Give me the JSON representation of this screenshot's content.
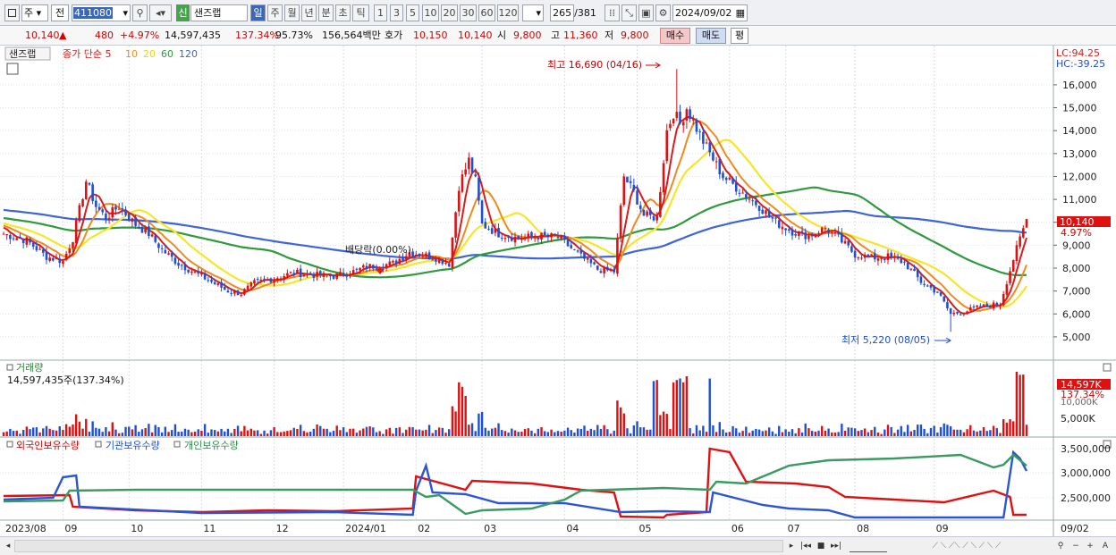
{
  "toolbar": {
    "mode_1": "주",
    "mode_2": "전",
    "code": "411080",
    "sin": "신",
    "name": "샌즈랩",
    "periods": [
      "일",
      "주",
      "월",
      "년",
      "분",
      "초",
      "틱"
    ],
    "ticks": [
      "1",
      "3",
      "5",
      "10",
      "20",
      "30",
      "60",
      "120"
    ],
    "page": "265",
    "page_total": "/381",
    "date": "2024/09/02"
  },
  "info": {
    "price": "10,140",
    "arrow": "▲",
    "change": "480",
    "change_pct": "+4.97%",
    "volume": "14,597,435",
    "vol_ratio": "137.34%",
    "ratio2": "95.73%",
    "amount": "156,564백만",
    "quote_label": "호가",
    "quote1": "10,150",
    "quote2": "10,140",
    "open_label": "시",
    "open": "9,800",
    "high_label": "고",
    "high": "11,360",
    "low_label": "저",
    "low": "9,800",
    "buy": "매수",
    "sell": "매도",
    "f": "평"
  },
  "price_panel": {
    "legend_name": "샌즈랩",
    "legend_ma": "종가 단순 5",
    "ma10": "10",
    "ma20": "20",
    "ma60": "60",
    "ma120": "120",
    "lc": "LC:94.25",
    "hc": "HC:-39.25",
    "max_label": "최고 16,690 (04/16)",
    "min_label": "최저 5,220 (08/05)",
    "div_label": "배당락(0.00%)",
    "cur_price": "10,140",
    "cur_pct": "4.97%"
  },
  "volume_panel": {
    "title": "거래량",
    "value": "14,597,435주(137.34%)",
    "tag1": "14,597K",
    "tag2": "137.34%",
    "tag3": "10,000K",
    "tag4": "5,000K"
  },
  "holding_panel": {
    "legend1": "외국인보유수량",
    "legend2": "기관보유수량",
    "legend3": "개인보유수량"
  },
  "x_labels": [
    "2023/08",
    "09",
    "10",
    "11",
    "12",
    "2024/01",
    "02",
    "03",
    "04",
    "05",
    "06",
    "07",
    "08",
    "09",
    "09/02"
  ],
  "colors": {
    "up": "#e01010",
    "down": "#1f4fd6",
    "ma5": "#d81d1d",
    "ma10": "#f08a1b",
    "ma20": "#f7e528",
    "ma60": "#2f9a3c",
    "ma120": "#3f63d8",
    "foreign": "#e01010",
    "inst": "#2b55d6",
    "indiv": "#3a9a5f"
  },
  "chart_data": [
    {
      "type": "candlestick",
      "title": "샌즈랩",
      "y_ticks": [
        16000,
        15000,
        14000,
        13000,
        12000,
        11000,
        10000,
        9000,
        8000,
        7000,
        6000,
        5000
      ],
      "ylim": [
        4450,
        17400
      ],
      "high": {
        "date": "2024/04/16",
        "value": 16690
      },
      "low": {
        "date": "2024/08/05",
        "value": 5220
      },
      "last": 10140,
      "price_path": [
        [
          0,
          9500
        ],
        [
          7,
          9200
        ],
        [
          13,
          8500
        ],
        [
          18,
          8300
        ],
        [
          21,
          9300
        ],
        [
          25,
          11800
        ],
        [
          28,
          10700
        ],
        [
          31,
          10200
        ],
        [
          35,
          10700
        ],
        [
          40,
          9900
        ],
        [
          44,
          9500
        ],
        [
          48,
          8800
        ],
        [
          53,
          8200
        ],
        [
          58,
          7800
        ],
        [
          63,
          7400
        ],
        [
          68,
          7000
        ],
        [
          72,
          6900
        ],
        [
          76,
          7350
        ],
        [
          83,
          7600
        ],
        [
          88,
          7800
        ],
        [
          94,
          7700
        ],
        [
          100,
          7650
        ],
        [
          105,
          7800
        ],
        [
          110,
          8050
        ],
        [
          118,
          8200
        ],
        [
          123,
          8700
        ],
        [
          131,
          8450
        ],
        [
          135,
          8200
        ],
        [
          138,
          11600
        ],
        [
          141,
          12700
        ],
        [
          143,
          11800
        ],
        [
          145,
          9900
        ],
        [
          150,
          9500
        ],
        [
          156,
          9300
        ],
        [
          162,
          9400
        ],
        [
          168,
          9350
        ],
        [
          175,
          8500
        ],
        [
          180,
          7950
        ],
        [
          185,
          7850
        ],
        [
          188,
          12000
        ],
        [
          191,
          11300
        ],
        [
          194,
          10300
        ],
        [
          198,
          10200
        ],
        [
          201,
          14000
        ],
        [
          203,
          14800
        ],
        [
          205,
          14300
        ],
        [
          207,
          15000
        ],
        [
          211,
          13800
        ],
        [
          214,
          13000
        ],
        [
          218,
          12000
        ],
        [
          224,
          11300
        ],
        [
          229,
          10700
        ],
        [
          234,
          10000
        ],
        [
          239,
          9600
        ],
        [
          244,
          9400
        ],
        [
          249,
          9750
        ],
        [
          253,
          9300
        ],
        [
          258,
          8600
        ],
        [
          263,
          8450
        ],
        [
          268,
          8500
        ],
        [
          273,
          8250
        ],
        [
          278,
          7400
        ],
        [
          283,
          6950
        ],
        [
          287,
          6000
        ],
        [
          291,
          6100
        ],
        [
          296,
          6300
        ],
        [
          302,
          6450
        ],
        [
          306,
          8400
        ],
        [
          309,
          9700
        ],
        [
          310,
          10140
        ]
      ]
    },
    {
      "type": "bar",
      "title": "거래량",
      "y_ticks_label": [
        "10,000K",
        "5,000K"
      ],
      "series_note": "spikes near 2024/02, 2024/04, 2024/09"
    },
    {
      "type": "line",
      "series": [
        {
          "name": "외국인보유수량"
        },
        {
          "name": "기관보유수량"
        },
        {
          "name": "개인보유수량"
        }
      ],
      "y_ticks": [
        "3,500,000",
        "3,000,000",
        "2,500,000"
      ]
    }
  ]
}
